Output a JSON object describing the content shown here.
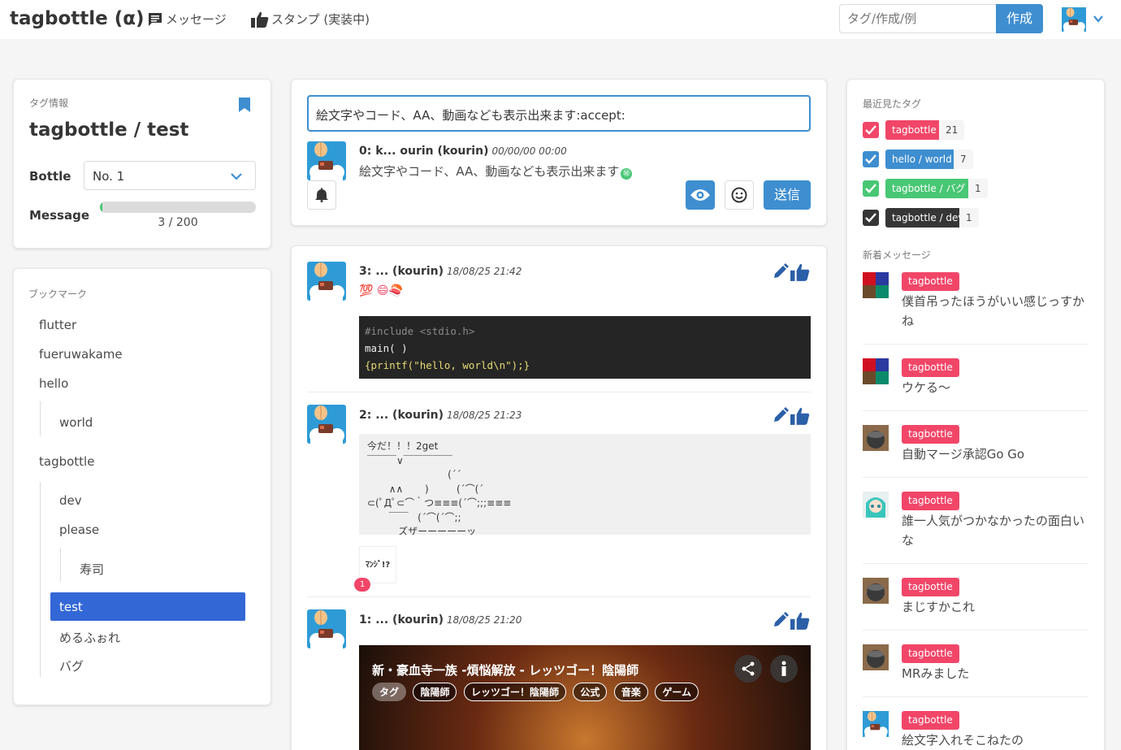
{
  "nav": {
    "brand": "tagbottle (α)",
    "messages": "メッセージ",
    "stamps": "スタンプ (実装中)",
    "tag_placeholder": "タグ/作成/例",
    "create": "作成"
  },
  "info": {
    "label": "タグ情報",
    "title": "tagbottle / test",
    "bottle_label": "Bottle",
    "bottle_value": "No. 1",
    "message_label": "Message",
    "message_progress": 0.015,
    "message_count": "3 / 200"
  },
  "bookmarks": {
    "label": "ブックマーク",
    "items": [
      "flutter",
      "fueruwakame",
      "hello",
      "world",
      "tagbottle",
      "dev",
      "please",
      "寿司",
      "test",
      "めるふぉれ",
      "バグ"
    ]
  },
  "composer": {
    "input": "絵文字やコード、AA、動画なども表示出来ます:accept:",
    "preview_title": "0: k... ourin (kourin)",
    "preview_time": "00/00/00 00:00",
    "preview_text": "絵文字やコード、AA、動画なども表示出来ます",
    "preview_emoji": "㊙",
    "send": "送信"
  },
  "posts": [
    {
      "title": "3: ... (kourin)",
      "time": "18/08/25 21:42",
      "emoji": "💯 😄🍣",
      "code": [
        "#include <stdio.h>",
        "main( )",
        "{printf(\"hello, world\\n\");}"
      ]
    },
    {
      "title": "2: ... (kourin)",
      "time": "18/08/25 21:23",
      "aa": "今だ！！！2get\n￣￣￣∨￣￣￣￣￣\n                          (´´\n       ∧∧       )         (´⌒(´\n⊂(ﾟДﾟ⊂⌒｀つ≡≡≡(´⌒;;;≡≡≡\n       ￣￣   (´⌒(´⌒;;\n          ズザーーーーーッ",
      "stamp": "ﾏﾝｼﾞ!?",
      "stamp_count": "1"
    },
    {
      "title": "1: ... (kourin)",
      "time": "18/08/25 21:20",
      "video_title": "新・豪血寺一族 -煩悩解放 - レッツゴー！陰陽師",
      "video_tags": [
        "タグ",
        "陰陽師",
        "レッツゴー！陰陽師",
        "公式",
        "音楽",
        "ゲーム"
      ]
    }
  ],
  "recent": {
    "label": "最近見たタグ",
    "items": [
      {
        "tag": "tagbottle",
        "count": "21",
        "color": "#f14668"
      },
      {
        "tag": "hello / world",
        "count": "7",
        "color": "#3e8ed0"
      },
      {
        "tag": "tagbottle / バグ",
        "count": "1",
        "color": "#48c774"
      },
      {
        "tag": "tagbottle / dev",
        "count": "1",
        "color": "#363636"
      }
    ]
  },
  "new_messages": {
    "label": "新着メッセージ",
    "items": [
      {
        "tag": "tagbottle",
        "text": "僕首吊ったほうがいい感じっすかね"
      },
      {
        "tag": "tagbottle",
        "text": "ウケる〜"
      },
      {
        "tag": "tagbottle",
        "text": "自動マージ承認Go Go"
      },
      {
        "tag": "tagbottle",
        "text": "誰一人気がつかなかったの面白いな"
      },
      {
        "tag": "tagbottle",
        "text": "まじすかこれ"
      },
      {
        "tag": "tagbottle",
        "text": "MRみました"
      },
      {
        "tag": "tagbottle",
        "text": "絵文字入れそこねたの"
      }
    ]
  }
}
